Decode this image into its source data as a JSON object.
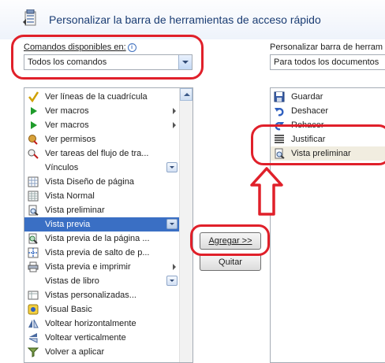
{
  "dialog": {
    "title": "Personalizar la barra de herramientas de acceso rápido"
  },
  "left": {
    "label": "Comandos disponibles en:",
    "combo_value": "Todos los comandos",
    "items": [
      {
        "label": "Ver líneas de la cuadrícula",
        "icon": "check-icon"
      },
      {
        "label": "Ver macros",
        "icon": "play-icon"
      },
      {
        "label": "Ver macros",
        "icon": "play-icon"
      },
      {
        "label": "Ver permisos",
        "icon": "permission-icon"
      },
      {
        "label": "Ver tareas del flujo de tra...",
        "icon": "workflow-icon"
      },
      {
        "label": "Vínculos",
        "icon": ""
      },
      {
        "label": "Vista Diseño de página",
        "icon": "page-layout-icon"
      },
      {
        "label": "Vista Normal",
        "icon": "normal-view-icon"
      },
      {
        "label": "Vista preliminar",
        "icon": "print-preview-icon"
      },
      {
        "label": "Vista previa",
        "icon": ""
      },
      {
        "label": "Vista previa de la página ...",
        "icon": "page-preview-icon"
      },
      {
        "label": "Vista previa de salto de p...",
        "icon": "page-break-preview-icon"
      },
      {
        "label": "Vista previa e imprimir",
        "icon": "print-icon"
      },
      {
        "label": "Vistas de libro",
        "icon": ""
      },
      {
        "label": "Vistas personalizadas...",
        "icon": "custom-views-icon"
      },
      {
        "label": "Visual Basic",
        "icon": "visual-basic-icon"
      },
      {
        "label": "Voltear horizontalmente",
        "icon": "flip-horizontal-icon"
      },
      {
        "label": "Voltear verticalmente",
        "icon": "flip-vertical-icon"
      },
      {
        "label": "Volver a aplicar",
        "icon": "reapply-filter-icon"
      }
    ]
  },
  "right": {
    "label": "Personalizar barra de herram",
    "combo_value": "Para todos los documentos",
    "items": [
      {
        "label": "Guardar",
        "icon": "save-icon"
      },
      {
        "label": "Deshacer",
        "icon": "undo-icon"
      },
      {
        "label": "Rehacer",
        "icon": "redo-icon"
      },
      {
        "label": "Justificar",
        "icon": "justify-icon"
      },
      {
        "label": "Vista preliminar",
        "icon": "print-preview-icon"
      }
    ]
  },
  "buttons": {
    "add": "Agregar >>",
    "remove": "Quitar"
  },
  "colors": {
    "highlight": "#e0202a",
    "selection": "#3a6fc4",
    "title": "#1b3d73"
  }
}
